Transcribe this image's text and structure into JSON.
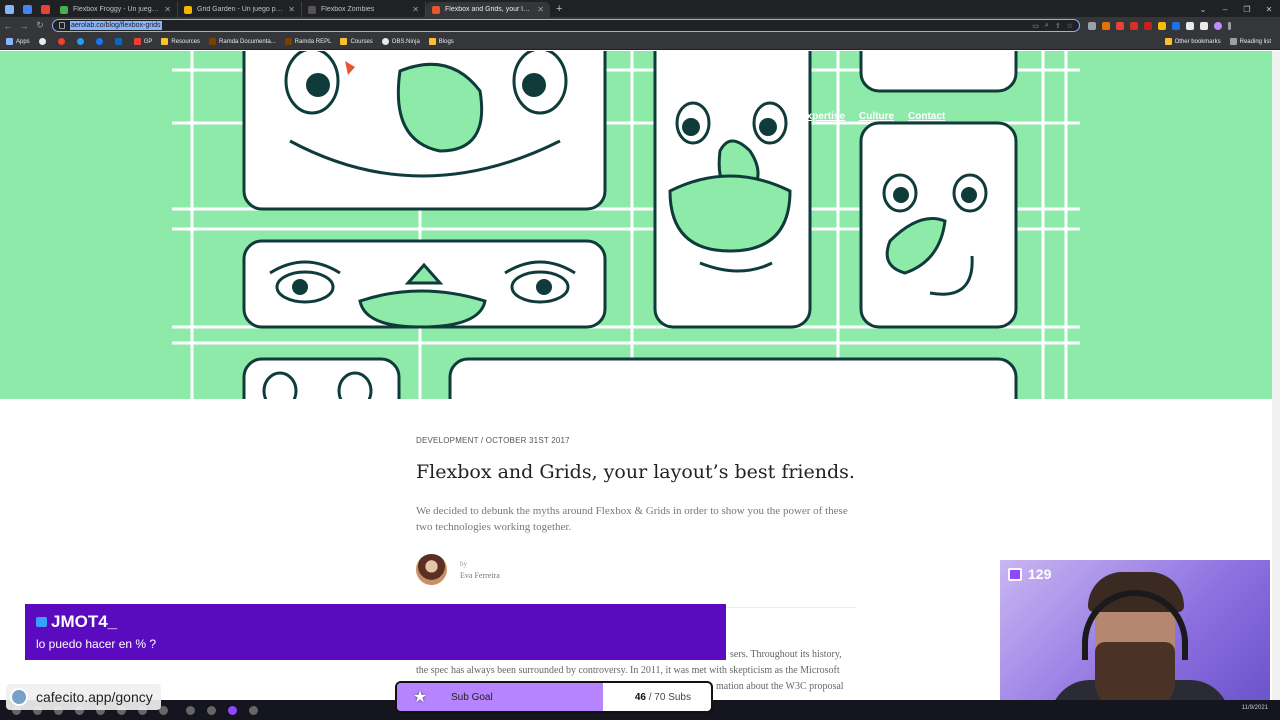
{
  "browser": {
    "tabs": [
      {
        "label": "Flexbox Froggy - Un juego para...",
        "color": "#4caf50"
      },
      {
        "label": "Grid Garden - Un juego para apr...",
        "color": "#f4b400"
      },
      {
        "label": "Flexbox Zombies",
        "color": "#555555"
      },
      {
        "label": "Flexbox and Grids, your layout's b...",
        "color": "#e8552f"
      }
    ],
    "new_tab": "+",
    "url": "aerolab.co/blog/flexbox-grids"
  },
  "bookmarks": {
    "items": [
      "Apps",
      "GP",
      "Resources",
      "Ramda Documenta...",
      "Ramda REPL",
      "Courses",
      "OBS.Ninja",
      "Blogs"
    ],
    "other": "Other bookmarks",
    "reading": "Reading list"
  },
  "hero": {
    "nav": [
      "Expertise",
      "Culture",
      "Contact"
    ],
    "bg_color": "#8eeaa8"
  },
  "article": {
    "meta": "DEVELOPMENT / OCTOBER 31ST 2017",
    "title": "Flexbox and Grids, your layout’s best friends.",
    "lead": "We decided to debunk the myths around Flexbox & Grids in order to show you the power of these two technologies working together.",
    "by": "by",
    "author": "Eva Ferreira",
    "body_line1": "sers. Throughout its history,",
    "body_line2": "the spec has always been surrounded by controversy. In 2011, it was met with skepticism as the Microsoft",
    "body_line3": "mation about the W3C proposal"
  },
  "chat": {
    "username": "JMOT4_",
    "message": "lo puedo hacer en % ?",
    "bg_color": "#5a0bbf"
  },
  "webcam": {
    "viewers": "129"
  },
  "subgoal": {
    "label": "Sub Goal",
    "current": "46",
    "total_text": "/ 70 Subs",
    "progress": 0.657
  },
  "cafecito": "cafecito.app/goncy",
  "clock": "11/9/2021"
}
